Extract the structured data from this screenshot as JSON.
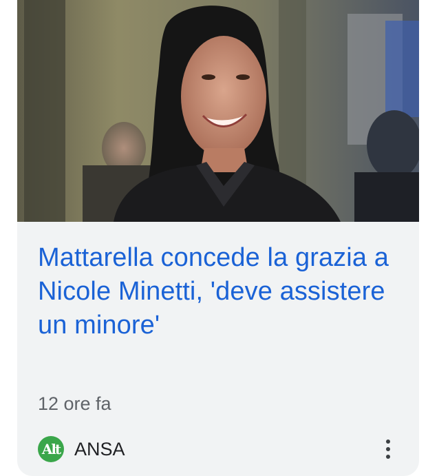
{
  "article": {
    "headline": "Mattarella concede la grazia a Nicole Minetti, 'deve assistere un minore'",
    "time": "12 ore fa",
    "source": {
      "name": "ANSA",
      "logo_text": "Alt",
      "logo_color": "#3aa64a"
    },
    "more_icon": "more-vert-icon"
  },
  "colors": {
    "headline": "#1a62d6",
    "card_bg": "#f1f3f4"
  }
}
